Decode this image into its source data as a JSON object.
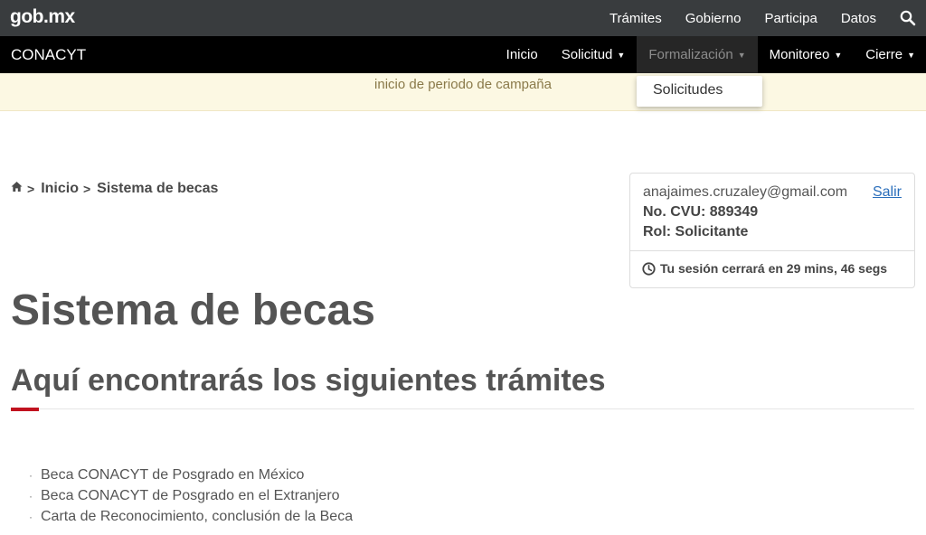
{
  "gob_bar": {
    "logo": "gob.mx",
    "nav": [
      "Trámites",
      "Gobierno",
      "Participa",
      "Datos"
    ]
  },
  "conacyt_bar": {
    "brand": "CONACYT",
    "nav": [
      {
        "label": "Inicio",
        "has_caret": false
      },
      {
        "label": "Solicitud",
        "has_caret": true
      },
      {
        "label": "Formalización",
        "has_caret": true,
        "active": true
      },
      {
        "label": "Monitoreo",
        "has_caret": true
      },
      {
        "label": "Cierre",
        "has_caret": true
      }
    ],
    "caret": "▼"
  },
  "dropdown": {
    "items": [
      "Solicitudes"
    ]
  },
  "notice": {
    "text": "inicio de periodo de campaña"
  },
  "breadcrumb": {
    "items": [
      "Inicio",
      "Sistema de becas"
    ],
    "separator": ">"
  },
  "session": {
    "email": "anajaimes.cruzaley@gmail.com",
    "logout": "Salir",
    "cvu": "No. CVU: 889349",
    "rol": "Rol: Solicitante",
    "timer": "Tu sesión cerrará en 29 mins, 46 segs"
  },
  "main": {
    "title": "Sistema de becas",
    "subtitle": "Aquí encontrarás los siguientes trámites",
    "items": [
      "Beca CONACYT de Posgrado en México",
      "Beca CONACYT de Posgrado en el Extranjero",
      "Carta de Reconocimiento, conclusión de la Beca"
    ],
    "bullet": "·"
  },
  "colors": {
    "gob_bar": "#393c3e",
    "conacyt_bar": "#000000",
    "notice_bg": "#fcf8e3",
    "accent": "#c1121f",
    "link": "#2a6ebb"
  },
  "icons": [
    "search-icon",
    "home-icon",
    "clock-icon",
    "chevron-right-icon",
    "caret-down-icon"
  ]
}
